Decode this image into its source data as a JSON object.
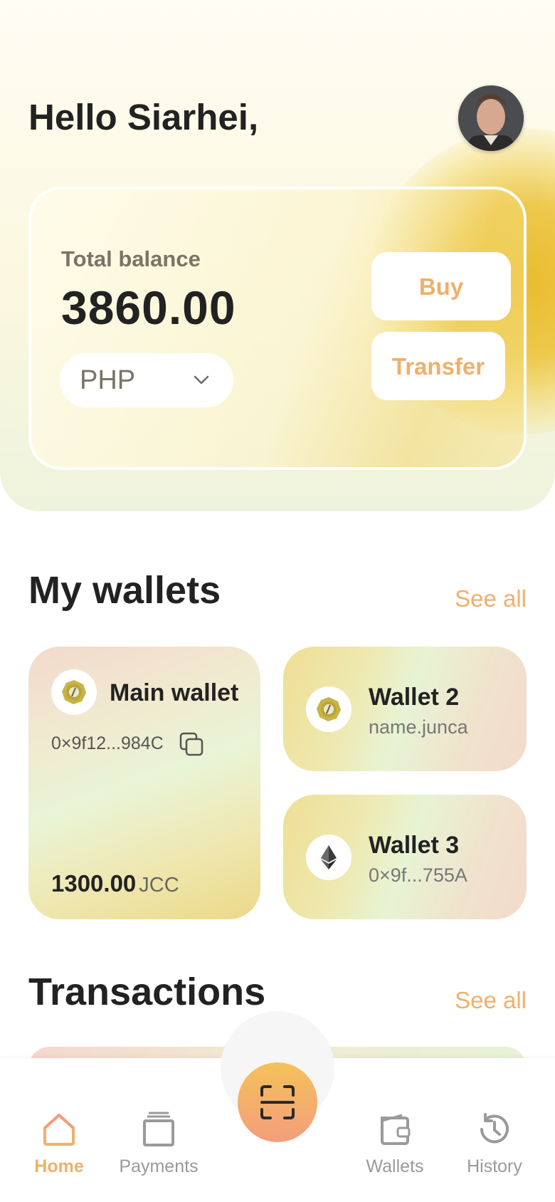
{
  "header": {
    "greeting": "Hello Siarhei,",
    "avatar_icon": "user-avatar"
  },
  "balance": {
    "label": "Total balance",
    "value": "3860.00",
    "currency": "PHP",
    "buy_label": "Buy",
    "transfer_label": "Transfer"
  },
  "wallets_section": {
    "title": "My wallets",
    "see_all": "See all",
    "items": [
      {
        "name": "Main wallet",
        "address": "0×9f12...984C",
        "amount": "1300.00",
        "unit": "JCC",
        "icon": "coin-icon"
      },
      {
        "name": "Wallet 2",
        "sub": "name.junca",
        "icon": "coin-icon"
      },
      {
        "name": "Wallet 3",
        "sub": "0×9f...755A",
        "icon": "ethereum-icon"
      }
    ]
  },
  "transactions_section": {
    "title": "Transactions",
    "see_all": "See all"
  },
  "nav": {
    "items": [
      {
        "label": "Home",
        "icon": "home-icon",
        "active": true
      },
      {
        "label": "Payments",
        "icon": "payments-icon"
      },
      {
        "label": "Wallets",
        "icon": "wallet-icon"
      },
      {
        "label": "History",
        "icon": "history-icon"
      }
    ],
    "scan_icon": "scan-icon"
  },
  "colors": {
    "accent": "#efb06a",
    "text": "#222222",
    "muted": "#7a7466"
  }
}
